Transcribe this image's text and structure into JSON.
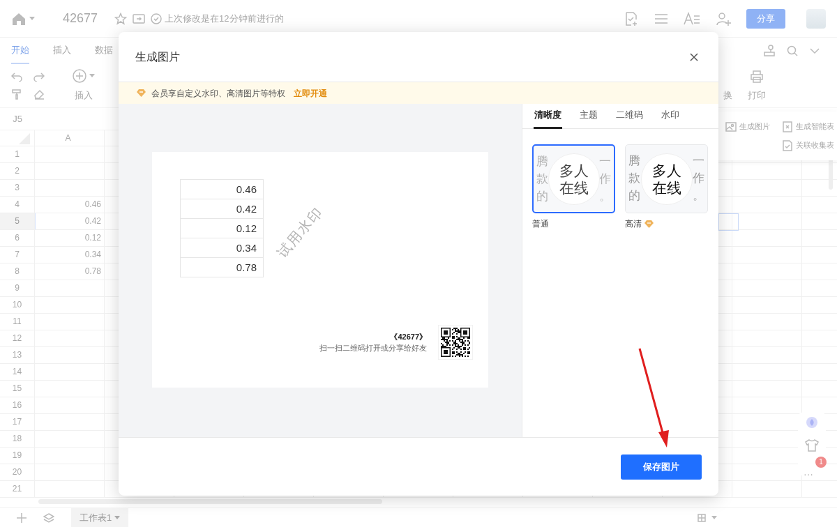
{
  "app": {
    "title": "42677",
    "status": "上次修改是在12分钟前进行的",
    "share_button": "分享"
  },
  "ribbon": {
    "tabs": [
      {
        "label": "开始",
        "selected": true
      },
      {
        "label": "插入",
        "selected": false
      },
      {
        "label": "数据",
        "selected": false
      }
    ],
    "insert_label": "插入",
    "right_tools": [
      "换",
      "打印"
    ]
  },
  "side_menu": {
    "items": [
      "生成图片",
      "生成智能表",
      "关联收集表"
    ]
  },
  "sheet": {
    "name_box": "J5",
    "column": "A",
    "rows": [
      {
        "number": "1",
        "selected": false
      },
      {
        "number": "2",
        "selected": false
      },
      {
        "number": "3",
        "selected": false
      },
      {
        "number": "4",
        "value": "0.46",
        "selected": false
      },
      {
        "number": "5",
        "value": "0.42",
        "selected": true
      },
      {
        "number": "6",
        "value": "0.12",
        "selected": false
      },
      {
        "number": "7",
        "value": "0.34",
        "selected": false
      },
      {
        "number": "8",
        "value": "0.78",
        "selected": false
      },
      {
        "number": "9",
        "selected": false
      },
      {
        "number": "10",
        "selected": false
      },
      {
        "number": "11",
        "selected": false
      },
      {
        "number": "12",
        "selected": false
      },
      {
        "number": "13",
        "selected": false
      },
      {
        "number": "14",
        "selected": false
      },
      {
        "number": "15",
        "selected": false
      },
      {
        "number": "16",
        "selected": false
      },
      {
        "number": "17",
        "selected": false
      },
      {
        "number": "18",
        "selected": false
      },
      {
        "number": "19",
        "selected": false
      },
      {
        "number": "20",
        "selected": false
      },
      {
        "number": "21",
        "selected": false
      }
    ]
  },
  "float_badge": "1",
  "float_more": "···",
  "sheet_tabs": [
    {
      "label": "工作表1",
      "selected": true
    }
  ],
  "dialog": {
    "title": "生成图片",
    "banner": {
      "text": "会员享自定义水印、高清图片等特权",
      "link": "立即开通"
    },
    "preview": {
      "values": [
        "0.46",
        "0.42",
        "0.12",
        "0.34",
        "0.78"
      ],
      "watermark": "试用水印",
      "doc_title": "《42677》",
      "caption": "扫一扫二维码打开或分享给好友"
    },
    "tabs": [
      {
        "label": "清晰度",
        "selected": true
      },
      {
        "label": "主题",
        "selected": false
      },
      {
        "label": "二维码",
        "selected": false
      },
      {
        "label": "水印",
        "selected": false
      }
    ],
    "options": [
      {
        "label": "普通",
        "selected": true,
        "premium": false,
        "blurred": true,
        "sample_lines": [
          [
            "腾",
            "一"
          ],
          [
            "款",
            "作"
          ],
          [
            "的",
            "。"
          ]
        ],
        "badge_text": [
          "多人",
          "在线"
        ]
      },
      {
        "label": "高清",
        "selected": false,
        "premium": true,
        "blurred": false,
        "sample_lines": [
          [
            "腾",
            "一"
          ],
          [
            "款",
            "作"
          ],
          [
            "的",
            "。"
          ]
        ],
        "badge_text": [
          "多人",
          "在线"
        ]
      }
    ],
    "save_button": "保存图片"
  }
}
